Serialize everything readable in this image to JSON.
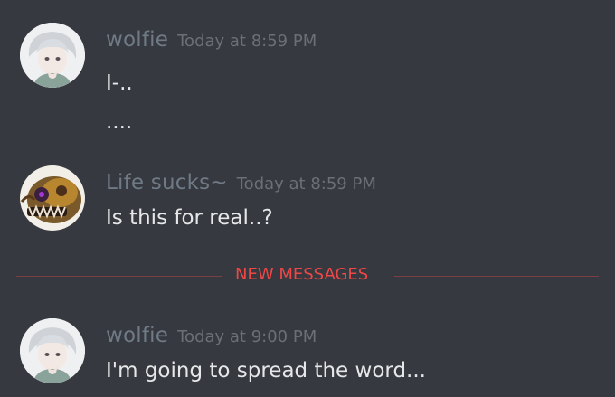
{
  "colors": {
    "background": "#36393f",
    "author": "#6f7a85",
    "timestamp": "#6b7077",
    "message_text": "#e6e7e8",
    "new_messages_accent": "#f04747"
  },
  "messages": [
    {
      "author": "wolfie",
      "timestamp": "Today at 8:59 PM",
      "lines": [
        "I-..",
        "...."
      ]
    },
    {
      "author": "Life sucks~",
      "timestamp": "Today at 8:59 PM",
      "lines": [
        "Is this for real..?"
      ]
    },
    {
      "author": "wolfie",
      "timestamp": "Today at 9:00 PM",
      "lines": [
        "I'm going to spread the word..."
      ]
    }
  ],
  "divider": {
    "label": "NEW MESSAGES"
  }
}
